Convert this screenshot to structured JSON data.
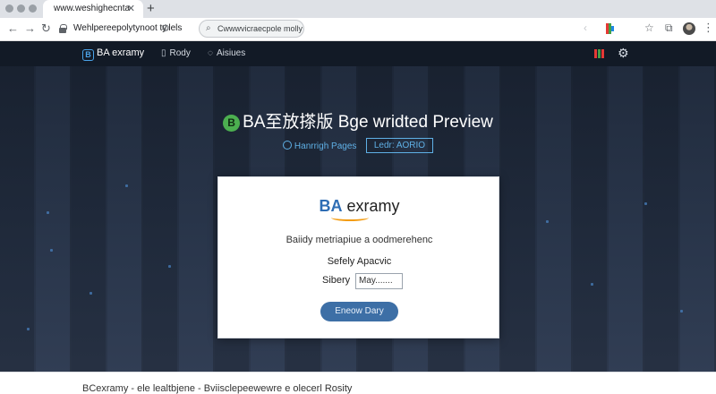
{
  "browser": {
    "tab_title": "www.weshighecnta",
    "tab_close": "✕",
    "new_tab": "+",
    "url": "Wehlpereepolytynoot ty.lels",
    "omnibox_text": "Cwwwvicraecpole molly",
    "icons": {
      "back": "back-arrow-icon",
      "forward": "forward-arrow-icon",
      "reload": "reload-icon",
      "lock": "lock-icon",
      "search": "search-icon",
      "extension": "extension-icon",
      "bookmark": "star-icon",
      "menu": "kebab-menu-icon"
    }
  },
  "site": {
    "brand": "BA exramy",
    "brand_icon_letter": "B",
    "nav": [
      {
        "label": "Rody",
        "icon": "document-icon"
      },
      {
        "label": "Aisiues",
        "icon": "chat-icon"
      }
    ],
    "status_colors": [
      "#e53935",
      "#43a047"
    ]
  },
  "hero": {
    "title": "BA至放搽版 Bge wridted Preview",
    "logo_letter": "B",
    "link_label": "Hanrrigh Pages",
    "button_label": "Ledr: AORIO"
  },
  "card": {
    "logo_ba": "BA",
    "logo_rest": " exramy",
    "subtitle": "Baiidy metriapiue a oodmerehenc",
    "row1": "Sefely  Apacvic",
    "row2_label": "Sibery",
    "input_value": "May.......",
    "button_label": "Eneow Dary"
  },
  "footer": {
    "text": "BCexramy - ele lealtbjene - Bviisclepeewewre e olecerl Rosity"
  },
  "colors": {
    "accent": "#5fb0e6",
    "button": "#3d6fa6",
    "hero_logo": "#4caf50",
    "smile": "#f39c12"
  }
}
